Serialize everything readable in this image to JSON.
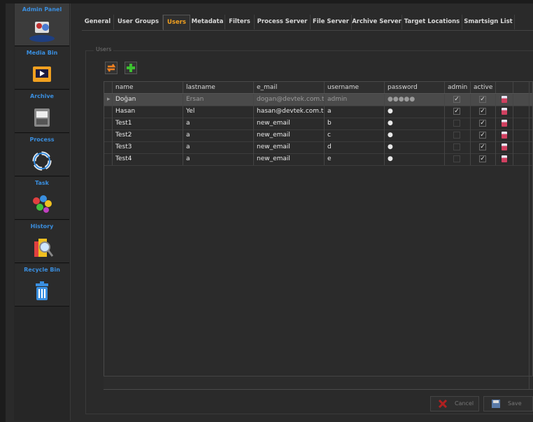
{
  "sidebar": {
    "items": [
      {
        "label": "Admin Panel",
        "icon": "admin-panel-icon"
      },
      {
        "label": "Media Bin",
        "icon": "media-bin-icon"
      },
      {
        "label": "Archive",
        "icon": "archive-icon"
      },
      {
        "label": "Process",
        "icon": "process-icon"
      },
      {
        "label": "Task",
        "icon": "task-icon"
      },
      {
        "label": "History",
        "icon": "history-icon"
      },
      {
        "label": "Recycle Bin",
        "icon": "recycle-bin-icon"
      }
    ]
  },
  "tabs": [
    "General",
    "User Groups",
    "Users",
    "Metadata",
    "Filters",
    "Process Server",
    "File Server",
    "Archive Server",
    "Target Locations",
    "Smartsign List"
  ],
  "active_tab": "Users",
  "group_label": "Users",
  "toolbar": {
    "refresh_icon": "refresh-icon",
    "add_icon": "add-icon"
  },
  "grid": {
    "columns": [
      "name",
      "lastname",
      "e_mail",
      "username",
      "password",
      "admin",
      "active",
      ""
    ],
    "rows": [
      {
        "name": "Doğan",
        "lastname": "Ersan",
        "email": "dogan@devtek.com.tr",
        "username": "admin",
        "password": "●●●●●",
        "admin": true,
        "active": true,
        "selected": true
      },
      {
        "name": "Hasan",
        "lastname": "Yel",
        "email": "hasan@devtek.com.tr",
        "username": "a",
        "password": "●",
        "admin": true,
        "active": true,
        "selected": false
      },
      {
        "name": "Test1",
        "lastname": "a",
        "email": "new_email",
        "username": "b",
        "password": "●",
        "admin": false,
        "active": true,
        "selected": false
      },
      {
        "name": "Test2",
        "lastname": "a",
        "email": "new_email",
        "username": "c",
        "password": "●",
        "admin": false,
        "active": true,
        "selected": false
      },
      {
        "name": "Test3",
        "lastname": "a",
        "email": "new_email",
        "username": "d",
        "password": "●",
        "admin": false,
        "active": true,
        "selected": false
      },
      {
        "name": "Test4",
        "lastname": "a",
        "email": "new_email",
        "username": "e",
        "password": "●",
        "admin": false,
        "active": true,
        "selected": false
      }
    ]
  },
  "buttons": {
    "cancel": "Cancel",
    "save": "Save"
  },
  "colors": {
    "accent_tab": "#f0a020",
    "sidebar_label": "#3a8fe0",
    "add_green": "#3cc030",
    "delete_red": "#d04060"
  }
}
